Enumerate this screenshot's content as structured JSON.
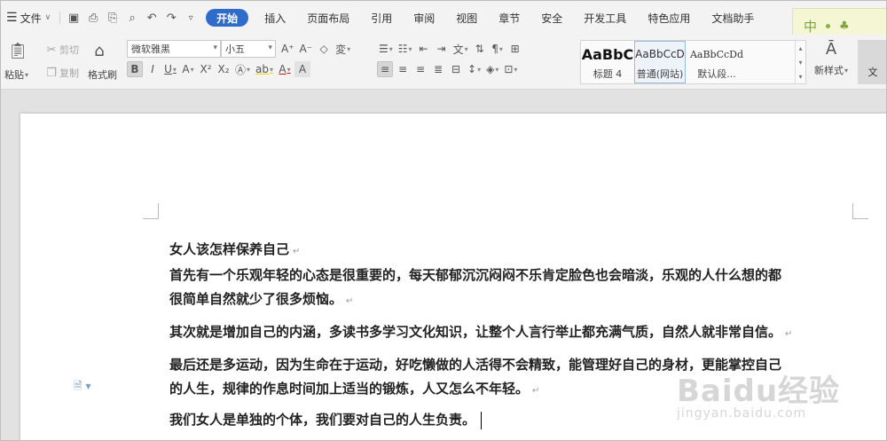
{
  "menubar": {
    "file_label": "文件",
    "tabs": [
      {
        "label": "开始",
        "active": true
      },
      {
        "label": "插入"
      },
      {
        "label": "页面布局"
      },
      {
        "label": "引用"
      },
      {
        "label": "审阅"
      },
      {
        "label": "视图"
      },
      {
        "label": "章节"
      },
      {
        "label": "安全"
      },
      {
        "label": "开发工具"
      },
      {
        "label": "特色应用"
      },
      {
        "label": "文档助手"
      }
    ],
    "accent": "#2f6cc9"
  },
  "ime": {
    "mode": "中"
  },
  "ribbon": {
    "paste_label": "粘贴",
    "cut_label": "剪切",
    "copy_label": "复制",
    "format_painter_label": "格式刷",
    "font_name": "微软雅黑",
    "font_size": "小五",
    "styles": [
      {
        "preview": "AaBbC",
        "label": "标题 4"
      },
      {
        "preview": "AaBbCcD",
        "label": "普通(网站)"
      },
      {
        "preview": "AaBbCcDd",
        "label": "默认段..."
      }
    ],
    "new_style_label": "新样式",
    "doc_tools_label": "文"
  },
  "document": {
    "title": "女人该怎样保养自己",
    "para1_line1": "首先有一个乐观年轻的心态是很重要的，每天郁郁沉沉闷闷不乐肯定脸色也会暗淡，乐观的人什么想的都",
    "para1_line2": "很简单自然就少了很多烦恼。",
    "para2": " 其次就是增加自己的内涵，多读书多学习文化知识，让整个人言行举止都充满气质，自然人就非常自信。",
    "para3_line1": "最后还是多运动，因为生命在于运动，好吃懒做的人活得不会精致，能管理好自己的身材，更能掌控自己",
    "para3_line2": "的人生，规律的作息时间加上适当的锻炼，人又怎么不年轻。",
    "para4": "我们女人是单独的个体，我们要对自己的人生负责。"
  },
  "watermark": {
    "brand": "Baidu经验",
    "url": "jingyan.baidu.com"
  }
}
